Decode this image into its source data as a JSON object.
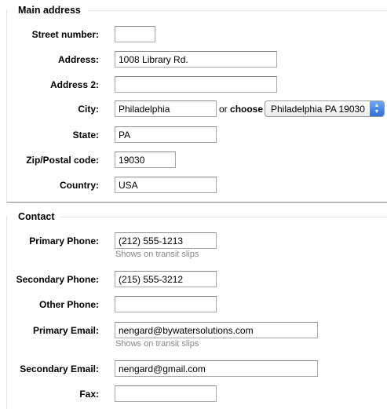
{
  "main_address": {
    "legend": "Main address",
    "street_number": {
      "label": "Street number:",
      "value": ""
    },
    "address": {
      "label": "Address:",
      "value": "1008 Library Rd."
    },
    "address2": {
      "label": "Address 2:",
      "value": ""
    },
    "city": {
      "label": "City:",
      "value": "Philadelphia",
      "or_text": "or",
      "choose_text": "choose",
      "select_value": "Philadelphia PA 19030"
    },
    "state": {
      "label": "State:",
      "value": "PA"
    },
    "zip": {
      "label": "Zip/Postal code:",
      "value": "19030"
    },
    "country": {
      "label": "Country:",
      "value": "USA"
    }
  },
  "contact": {
    "legend": "Contact",
    "primary_phone": {
      "label": "Primary Phone:",
      "value": "(212) 555-1213",
      "hint": "Shows on transit slips"
    },
    "secondary_phone": {
      "label": "Secondary Phone:",
      "value": "(215) 555-3212"
    },
    "other_phone": {
      "label": "Other Phone:",
      "value": ""
    },
    "primary_email": {
      "label": "Primary Email:",
      "value": "nengard@bywatersolutions.com",
      "hint": "Shows on transit slips"
    },
    "secondary_email": {
      "label": "Secondary Email:",
      "value": "nengard@gmail.com"
    },
    "fax": {
      "label": "Fax:",
      "value": ""
    }
  },
  "colors": {
    "select_arrow": "#3b7be0",
    "hint_text": "#888888"
  },
  "icons": {
    "select_arrow": "up-down-arrows-icon"
  }
}
